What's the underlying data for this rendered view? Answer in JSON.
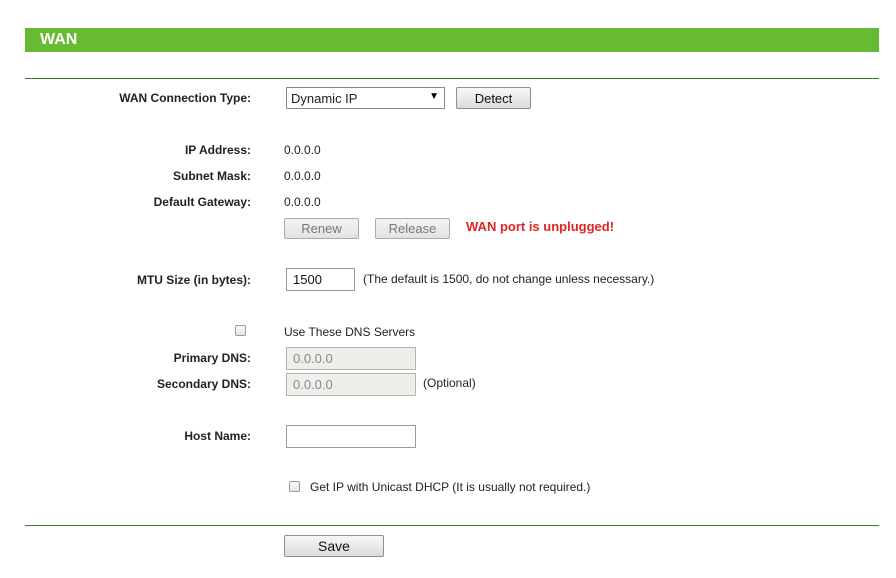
{
  "header": {
    "title": "WAN"
  },
  "wan_type": {
    "label": "WAN Connection Type:",
    "selected": "Dynamic IP",
    "detect_label": "Detect"
  },
  "status": {
    "ip_label": "IP Address:",
    "ip_value": "0.0.0.0",
    "mask_label": "Subnet Mask:",
    "mask_value": "0.0.0.0",
    "gateway_label": "Default Gateway:",
    "gateway_value": "0.0.0.0",
    "renew_label": "Renew",
    "release_label": "Release",
    "warning": "WAN port is unplugged!"
  },
  "mtu": {
    "label": "MTU Size (in bytes):",
    "value": "1500",
    "note": "(The default is 1500, do not change unless necessary.)"
  },
  "dns": {
    "use_label": "Use These DNS Servers",
    "use_checked": false,
    "primary_label": "Primary DNS:",
    "primary_value": "0.0.0.0",
    "secondary_label": "Secondary DNS:",
    "secondary_value": "0.0.0.0",
    "optional_note": "(Optional)"
  },
  "host": {
    "label": "Host Name:",
    "value": ""
  },
  "unicast": {
    "label": "Get IP with Unicast DHCP (It is usually not required.)",
    "checked": false
  },
  "save_label": "Save",
  "colors": {
    "header_bg": "#66bb33",
    "rule": "#2e7d32",
    "warning": "#e02424"
  }
}
